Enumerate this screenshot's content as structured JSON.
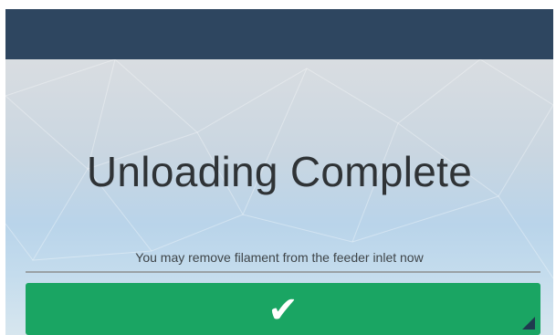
{
  "header": {
    "color": "#2e4660"
  },
  "dialog": {
    "title": "Unloading Complete",
    "message": "You may remove filament from the feeder inlet now",
    "confirm_icon": "check-icon",
    "confirm_glyph": "✔",
    "confirm_color": "#1aa563"
  }
}
